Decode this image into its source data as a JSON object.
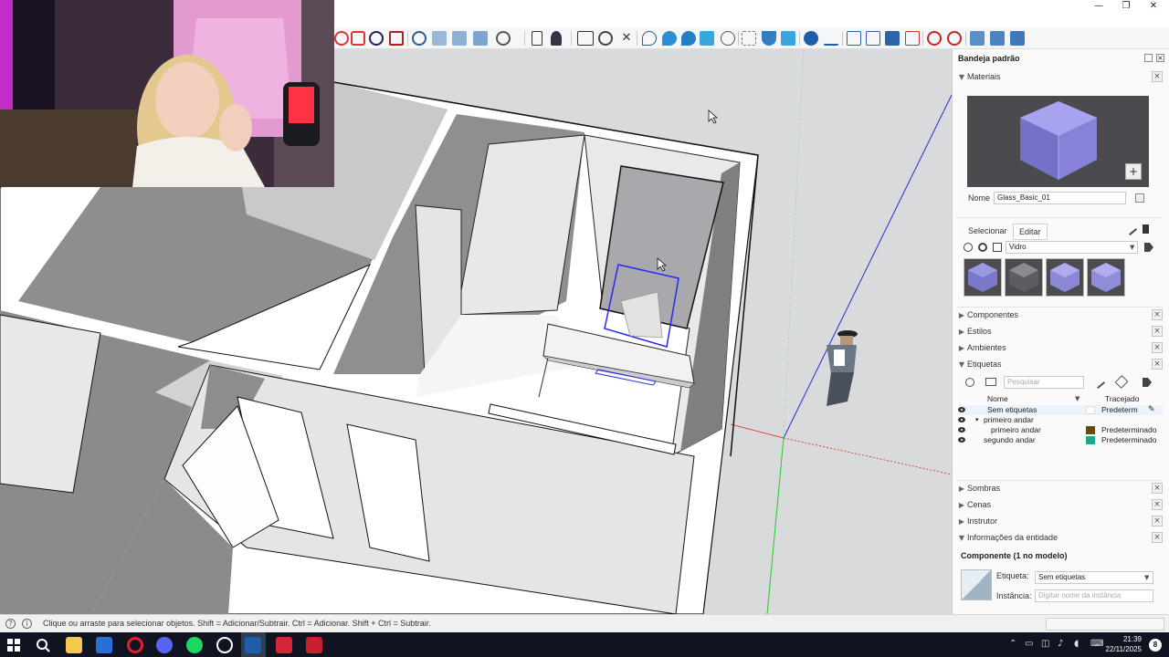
{
  "window": {
    "minimize_glyph": "—",
    "maximize_glyph": "❐",
    "close_glyph": "✕"
  },
  "toolbar": {
    "icons": [
      "orbit-icon",
      "pan-icon",
      "zoom-icon",
      "zoom-extents-icon",
      "section-plane-icon",
      "display-section-icon",
      "section-cuts-icon",
      "section-fill-icon",
      "geo-location-icon",
      "new-file-icon",
      "user-icon",
      "component-icon",
      "settings-icon",
      "close-x-icon",
      "sandbox-icon",
      "sandbox-stamp-icon",
      "sandbox-drape-icon",
      "water-drop-active-icon",
      "smoove-icon",
      "crosshair-icon",
      "magnet-icon",
      "magnet-active-icon",
      "add-point-icon",
      "measure-line-icon",
      "solid-union-icon",
      "solid-intersect-icon",
      "solid-shell-icon",
      "solid-trim-icon",
      "move-icon",
      "rotate-icon",
      "stack-icon-1",
      "stack-icon-2",
      "stack-icon-3"
    ]
  },
  "tray": {
    "title": "Bandeja padrão",
    "materials": {
      "header": "Materiais",
      "name_label": "Nome",
      "name_value": "Glass_Basic_01",
      "tab_select": "Selecionar",
      "tab_edit": "Editar",
      "library": "Vidro",
      "swatch_colors": [
        "#7a78c9",
        "#4a4a4e",
        "#8b88d6",
        "#8f8cdc"
      ]
    },
    "components_header": "Componentes",
    "styles_header": "Estilos",
    "environments_header": "Ambientes",
    "tags": {
      "header": "Etiquetas",
      "search_placeholder": "Pesquisar",
      "col_name": "Nome",
      "col_dash": "Tracejado",
      "rows": [
        {
          "name": "Sem etiquetas",
          "dash": "Predeterm",
          "color": "#ffffff",
          "indent": 0
        },
        {
          "name": "primeiro andar",
          "dash": "",
          "color": "",
          "indent": 0,
          "expander": "▾"
        },
        {
          "name": "primeiro andar",
          "dash": "Predeterminado",
          "color": "#6b4a12",
          "indent": 1
        },
        {
          "name": "segundo andar",
          "dash": "Predeterminado",
          "color": "#1aa98a",
          "indent": 0
        }
      ]
    },
    "shadows_header": "Sombras",
    "scenes_header": "Cenas",
    "instructor_header": "Instrutor",
    "entity_info": {
      "header": "Informações da entidade",
      "title": "Componente (1 no modelo)",
      "tag_label": "Etiqueta:",
      "tag_value": "Sem etiquetas",
      "instance_label": "Instância:",
      "instance_placeholder": "Digitar nome da instância"
    }
  },
  "status": {
    "message": "Clique ou arraste para selecionar objetos. Shift = Adicionar/Subtrair. Ctrl = Adicionar. Shift + Ctrl = Subtrair."
  },
  "taskbar": {
    "time": "21:39",
    "date": "22/11/2025",
    "notification_count": "8",
    "apps": [
      "windows-start-icon",
      "search-icon",
      "file-explorer-icon",
      "app-a-icon",
      "opera-icon",
      "discord-icon",
      "spotify-icon",
      "chatgpt-icon",
      "sketchup-icon",
      "streaming-app-icon",
      "layout-app-icon"
    ]
  }
}
